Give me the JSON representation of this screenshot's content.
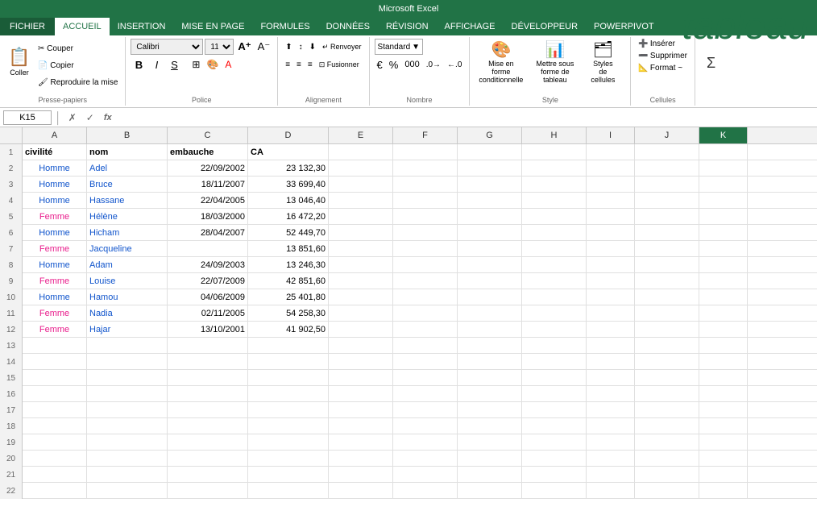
{
  "titleBar": {
    "text": "Microsoft Excel"
  },
  "ribbon": {
    "tabs": [
      "FICHIER",
      "ACCUEIL",
      "INSERTION",
      "MISE EN PAGE",
      "FORMULES",
      "DONNÉES",
      "RÉVISION",
      "AFFICHAGE",
      "DÉVELOPPEUR",
      "POWERPIVOT"
    ],
    "activeTab": "ACCUEIL",
    "groups": {
      "pressePapiers": {
        "label": "Presse-papiers"
      },
      "police": {
        "label": "Police",
        "font": "Calibri",
        "size": "11"
      },
      "alignement": {
        "label": "Alignement"
      },
      "nombre": {
        "label": "Nombre",
        "format": "Standard"
      },
      "style": {
        "label": "Style"
      },
      "cellules": {
        "label": "Cellules"
      }
    },
    "buttons": {
      "coller": "Coller",
      "inserer": "Insérer",
      "supprimer": "Supprimer",
      "format": "Format ~",
      "miseEnForme": "Mise en forme conditionnelle",
      "mettreSousForme": "Mettre sous forme de tableau",
      "stylesCellules": "Styles de cellules"
    }
  },
  "formulaBar": {
    "cellRef": "K15",
    "formula": ""
  },
  "tableau": {
    "label": "tableau"
  },
  "columns": [
    "A",
    "B",
    "C",
    "D",
    "E",
    "F",
    "G",
    "H",
    "I",
    "J",
    "K"
  ],
  "headers": {
    "A": "civilité",
    "B": "nom",
    "C": "embauche",
    "D": "CA"
  },
  "rows": [
    {
      "num": 2,
      "A": "Homme",
      "B": "Adel",
      "C": "22/09/2002",
      "D": "23 132,30",
      "aType": "homme",
      "bType": "blue"
    },
    {
      "num": 3,
      "A": "Homme",
      "B": "Bruce",
      "C": "18/11/2007",
      "D": "33 699,40",
      "aType": "homme",
      "bType": "blue"
    },
    {
      "num": 4,
      "A": "Homme",
      "B": "Hassane",
      "C": "22/04/2005",
      "D": "13 046,40",
      "aType": "homme",
      "bType": "blue"
    },
    {
      "num": 5,
      "A": "Femme",
      "B": "Hélène",
      "C": "18/03/2000",
      "D": "16 472,20",
      "aType": "femme",
      "bType": "blue"
    },
    {
      "num": 6,
      "A": "Homme",
      "B": "Hicham",
      "C": "28/04/2007",
      "D": "52 449,70",
      "aType": "homme",
      "bType": "blue"
    },
    {
      "num": 7,
      "A": "Femme",
      "B": "Jacqueline",
      "C": "",
      "D": "13 851,60",
      "aType": "femme",
      "bType": "blue"
    },
    {
      "num": 8,
      "A": "Homme",
      "B": "Adam",
      "C": "24/09/2003",
      "D": "13 246,30",
      "aType": "homme",
      "bType": "blue"
    },
    {
      "num": 9,
      "A": "Femme",
      "B": "Louise",
      "C": "22/07/2009",
      "D": "42 851,60",
      "aType": "femme",
      "bType": "blue"
    },
    {
      "num": 10,
      "A": "Homme",
      "B": "Hamou",
      "C": "04/06/2009",
      "D": "25 401,80",
      "aType": "homme",
      "bType": "blue"
    },
    {
      "num": 11,
      "A": "Femme",
      "B": "Nadia",
      "C": "02/11/2005",
      "D": "54 258,30",
      "aType": "femme",
      "bType": "blue"
    },
    {
      "num": 12,
      "A": "Femme",
      "B": "Hajar",
      "C": "13/10/2001",
      "D": "41 902,50",
      "aType": "femme",
      "bType": "blue"
    },
    {
      "num": 13,
      "A": "",
      "B": "",
      "C": "",
      "D": ""
    },
    {
      "num": 14,
      "A": "",
      "B": "",
      "C": "",
      "D": ""
    },
    {
      "num": 15,
      "A": "",
      "B": "",
      "C": "",
      "D": ""
    },
    {
      "num": 16,
      "A": "",
      "B": "",
      "C": "",
      "D": ""
    },
    {
      "num": 17,
      "A": "",
      "B": "",
      "C": "",
      "D": ""
    },
    {
      "num": 18,
      "A": "",
      "B": "",
      "C": "",
      "D": ""
    },
    {
      "num": 19,
      "A": "",
      "B": "",
      "C": "",
      "D": ""
    },
    {
      "num": 20,
      "A": "",
      "B": "",
      "C": "",
      "D": ""
    },
    {
      "num": 21,
      "A": "",
      "B": "",
      "C": "",
      "D": ""
    },
    {
      "num": 22,
      "A": "",
      "B": "",
      "C": "",
      "D": ""
    }
  ]
}
